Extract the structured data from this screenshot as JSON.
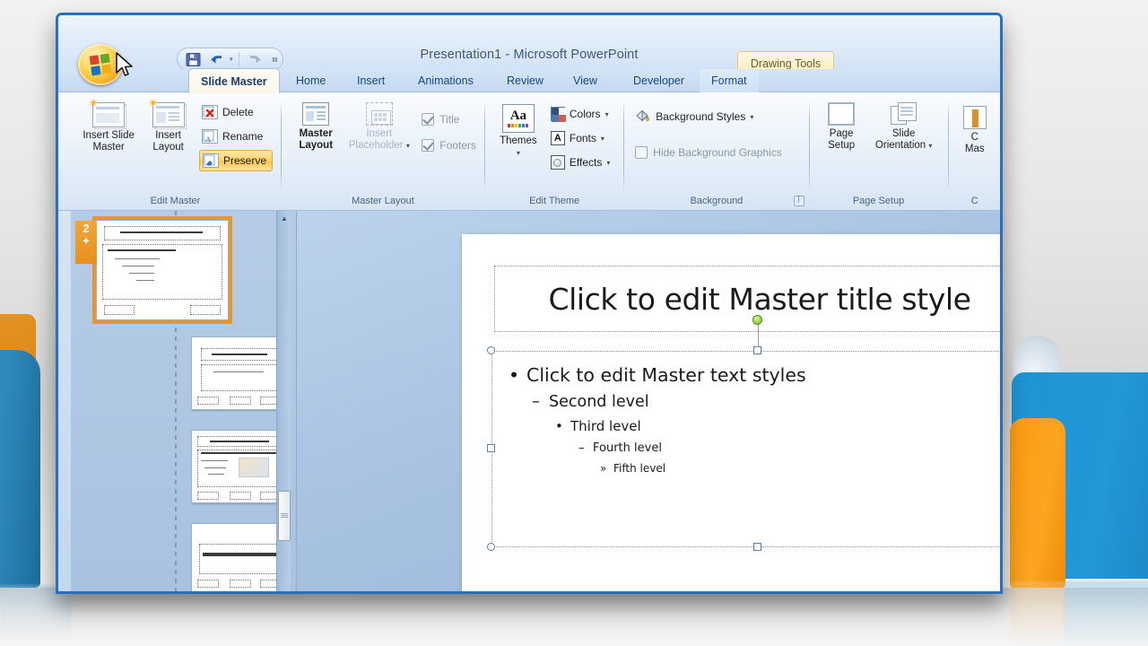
{
  "window": {
    "title": "Presentation1 - Microsoft PowerPoint",
    "office_button": "office-orb",
    "contextual_tab_group": "Drawing Tools"
  },
  "quick_access": {
    "items": [
      {
        "name": "save",
        "icon": "save-icon",
        "label": "Save"
      },
      {
        "name": "undo",
        "icon": "undo-icon",
        "label": "Undo"
      },
      {
        "name": "redo",
        "icon": "redo-icon",
        "label": "Redo"
      },
      {
        "name": "customize",
        "icon": "chevron-down-icon",
        "label": "Customize Quick Access Toolbar"
      }
    ]
  },
  "tabs": [
    {
      "label": "Slide Master",
      "active": true
    },
    {
      "label": "Home",
      "active": false
    },
    {
      "label": "Insert",
      "active": false
    },
    {
      "label": "Animations",
      "active": false
    },
    {
      "label": "Review",
      "active": false
    },
    {
      "label": "View",
      "active": false
    },
    {
      "label": "Developer",
      "active": false
    },
    {
      "label": "Format",
      "active": false,
      "contextual": true
    }
  ],
  "ribbon": {
    "groups": [
      {
        "name": "edit-master",
        "label": "Edit Master",
        "big_buttons": [
          {
            "line1": "Insert Slide",
            "line2": "Master"
          },
          {
            "line1": "Insert",
            "line2": "Layout"
          }
        ],
        "small_buttons": [
          {
            "label": "Delete",
            "icon": "delete-icon",
            "active": false
          },
          {
            "label": "Rename",
            "icon": "rename-icon",
            "active": false
          },
          {
            "label": "Preserve",
            "icon": "preserve-icon",
            "active": true
          }
        ]
      },
      {
        "name": "master-layout",
        "label": "Master Layout",
        "big_buttons": [
          {
            "line1": "Master",
            "line2": "Layout"
          },
          {
            "line1": "Insert",
            "line2": "Placeholder",
            "disabled": true,
            "dropdown": true
          }
        ],
        "checkboxes": [
          {
            "label": "Title",
            "checked": true
          },
          {
            "label": "Footers",
            "checked": true
          }
        ]
      },
      {
        "name": "edit-theme",
        "label": "Edit Theme",
        "big_buttons": [
          {
            "line1": "Themes",
            "line2": "",
            "dropdown": true
          }
        ],
        "small_buttons": [
          {
            "label": "Colors",
            "icon": "colors-icon",
            "dropdown": true
          },
          {
            "label": "Fonts",
            "icon": "fonts-icon",
            "dropdown": true
          },
          {
            "label": "Effects",
            "icon": "effects-icon",
            "dropdown": true
          }
        ]
      },
      {
        "name": "background",
        "label": "Background",
        "small_buttons": [
          {
            "label": "Background Styles",
            "icon": "paint-bucket-icon",
            "dropdown": true
          }
        ],
        "checkboxes": [
          {
            "label": "Hide Background Graphics",
            "checked": false
          }
        ],
        "dialog_launcher": true
      },
      {
        "name": "page-setup",
        "label": "Page Setup",
        "big_buttons": [
          {
            "line1": "Page",
            "line2": "Setup"
          },
          {
            "line1": "Slide",
            "line2": "Orientation",
            "dropdown": true
          }
        ]
      },
      {
        "name": "close-group",
        "label": "C",
        "big_buttons": [
          {
            "line1": "C",
            "line2": "Mas"
          }
        ]
      }
    ]
  },
  "thumbnails": {
    "selected_number": "2",
    "items": [
      {
        "type": "master",
        "selected": true
      },
      {
        "type": "layout",
        "selected": false
      },
      {
        "type": "layout",
        "selected": false
      },
      {
        "type": "layout",
        "selected": false
      }
    ],
    "scrollbar": {
      "up_arrow": "▲"
    }
  },
  "slide": {
    "title_placeholder": "Click to edit Master title style",
    "body_levels": [
      {
        "bullet": "•",
        "text": "Click to edit Master text styles"
      },
      {
        "bullet": "–",
        "text": "Second level"
      },
      {
        "bullet": "•",
        "text": "Third level"
      },
      {
        "bullet": "–",
        "text": "Fourth level"
      },
      {
        "bullet": "»",
        "text": "Fifth level"
      }
    ],
    "body_selected": true
  },
  "colors": {
    "window_border": "#2a6fbd",
    "active_tab": "#fbf7e9",
    "thumbnail_selection": "#e8962c",
    "preserve_highlight": "#fcc54a",
    "rotate_handle": "#74c21c"
  }
}
